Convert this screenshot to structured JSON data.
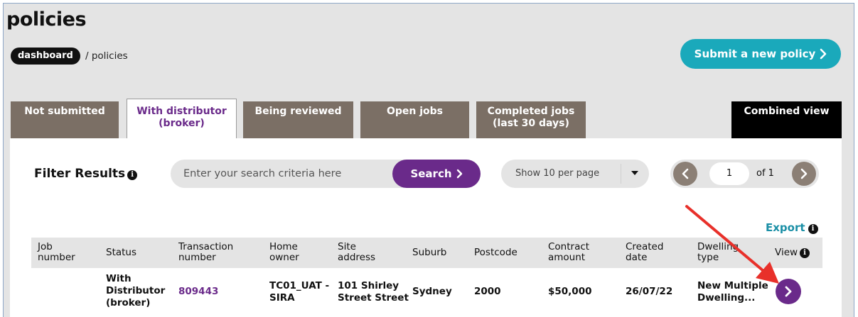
{
  "page": {
    "title": "policies"
  },
  "breadcrumb": {
    "home": "dashboard",
    "current": "/ policies"
  },
  "header": {
    "submit_label": "Submit a new policy"
  },
  "tabs": [
    {
      "label_line1": "Not submitted",
      "label_line2": ""
    },
    {
      "label_line1": "With distributor",
      "label_line2": "(broker)"
    },
    {
      "label_line1": "Being reviewed",
      "label_line2": ""
    },
    {
      "label_line1": "Open jobs",
      "label_line2": ""
    },
    {
      "label_line1": "Completed jobs",
      "label_line2": "(last 30 days)"
    },
    {
      "label_line1": "Combined view",
      "label_line2": ""
    }
  ],
  "active_tab": "With distributor (broker)",
  "filter": {
    "label": "Filter Results",
    "search_placeholder": "Enter your search criteria here",
    "search_button": "Search",
    "per_page": "Show 10 per page"
  },
  "pagination": {
    "current": "1",
    "of": "of 1"
  },
  "export": {
    "label": "Export"
  },
  "table": {
    "headers": [
      {
        "l1": "Job",
        "l2": "number"
      },
      {
        "l1": "Status",
        "l2": ""
      },
      {
        "l1": "Transaction",
        "l2": "number"
      },
      {
        "l1": "Home",
        "l2": "owner"
      },
      {
        "l1": "Site",
        "l2": "address"
      },
      {
        "l1": "Suburb",
        "l2": ""
      },
      {
        "l1": "Postcode",
        "l2": ""
      },
      {
        "l1": "Contract",
        "l2": "amount"
      },
      {
        "l1": "Created",
        "l2": "date"
      },
      {
        "l1": "Dwelling",
        "l2": "type"
      },
      {
        "l1": "View",
        "l2": ""
      }
    ],
    "rows": [
      {
        "job_number": "",
        "status": [
          "With",
          "Distributor",
          "(broker)"
        ],
        "transaction_number": "809443",
        "home_owner": [
          "TC01_UAT -",
          "SIRA"
        ],
        "site_address": [
          "101 Shirley",
          "Street Street"
        ],
        "suburb": "Sydney",
        "postcode": "2000",
        "contract_amount": "$50,000",
        "created_date": "26/07/22",
        "dwelling_type": [
          "New Multiple",
          "Dwelling..."
        ]
      }
    ]
  },
  "colors": {
    "brand_purple": "#6a2a8a",
    "teal": "#1aa9bb",
    "tab_brown": "#7b6f65",
    "annotation_red": "#e8302a"
  }
}
